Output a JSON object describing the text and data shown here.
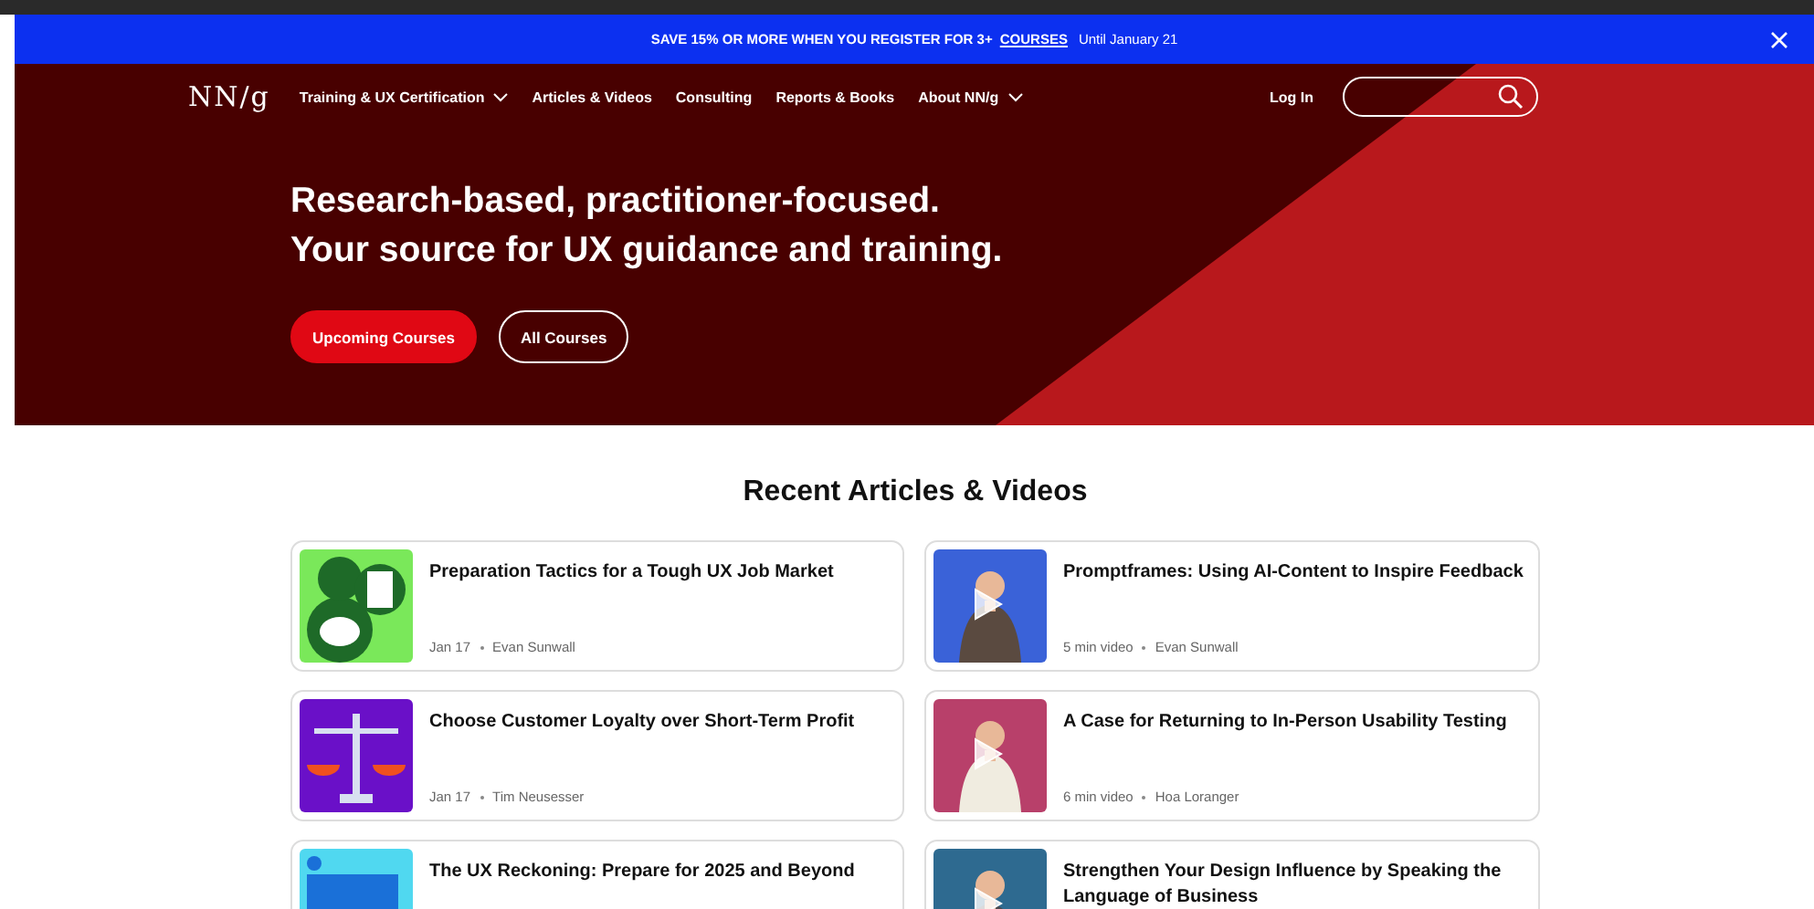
{
  "promo_banner": {
    "text": "SAVE 15% OR MORE WHEN YOU REGISTER FOR 3+",
    "link": "COURSES",
    "note": "Until January 21"
  },
  "nav": {
    "logo": "NN/g",
    "items": [
      {
        "label": "Training & UX Certification",
        "dropdown": true
      },
      {
        "label": "Articles & Videos",
        "dropdown": false
      },
      {
        "label": "Consulting",
        "dropdown": false
      },
      {
        "label": "Reports & Books",
        "dropdown": false
      },
      {
        "label": "About NN/g",
        "dropdown": true
      }
    ],
    "login": "Log In"
  },
  "hero": {
    "headline": [
      "Research-based, practitioner-focused.",
      "Your source for UX guidance and training."
    ],
    "buttons": [
      {
        "label": "Upcoming Courses",
        "kind": "primary"
      },
      {
        "label": "All Courses",
        "kind": "outline"
      }
    ]
  },
  "recent": {
    "title": "Recent Articles & Videos",
    "cards": [
      {
        "kind": "article",
        "title": "Preparation Tactics for a Tough UX Job Market",
        "meta": [
          "Jan 17",
          "Evan Sunwall"
        ]
      },
      {
        "kind": "video",
        "title": "Promptframes: Using AI-Content to Inspire Feedback",
        "meta": [
          "5 min video",
          "Evan Sunwall"
        ]
      },
      {
        "kind": "article",
        "title": "Choose Customer Loyalty over Short-Term Profit",
        "meta": [
          "Jan 17",
          "Tim Neusesser"
        ]
      },
      {
        "kind": "video",
        "title": "A Case for Returning to In-Person Usability Testing",
        "meta": [
          "6 min video",
          "Hoa Loranger"
        ]
      },
      {
        "kind": "article",
        "title": "The UX Reckoning: Prepare for 2025 and Beyond"
      },
      {
        "kind": "video",
        "title": "Strengthen Your Design Influence by Speaking the Language of Business"
      }
    ]
  }
}
